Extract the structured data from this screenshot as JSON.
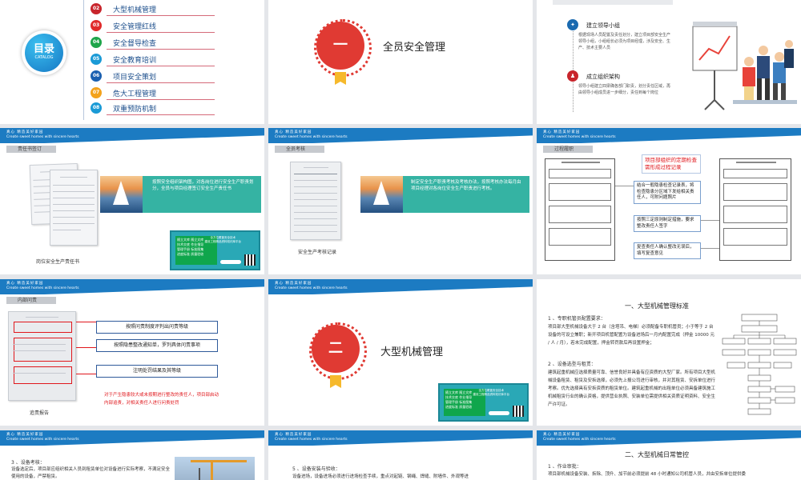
{
  "header": {
    "line1": "真心 精造美好家园",
    "line2": "Create sweet homes with sincere hearts"
  },
  "catalog": {
    "title": "目录",
    "subtitle": "CATALOG",
    "items": [
      {
        "num": "02",
        "label": "大型机械管理",
        "color": "#c8252c"
      },
      {
        "num": "03",
        "label": "安全管理红线",
        "color": "#e02b2b"
      },
      {
        "num": "04",
        "label": "安全督导检查",
        "color": "#1ea54a"
      },
      {
        "num": "05",
        "label": "安全教育培训",
        "color": "#1a9ad6"
      },
      {
        "num": "06",
        "label": "项目安全策划",
        "color": "#1b60b0"
      },
      {
        "num": "07",
        "label": "危大工程管理",
        "color": "#f3a21b"
      },
      {
        "num": "08",
        "label": "双重预防机制",
        "color": "#1a9ad6"
      }
    ]
  },
  "section1": {
    "numeral": "一",
    "title": "全员安全管理"
  },
  "section2": {
    "numeral": "二",
    "title": "大型机械管理"
  },
  "org": {
    "step1_title": "建立领导小组",
    "step1_text": "根据现场人员配置及责任划分，建立项目部安全生产领导小组，小组组长必须为项目经理，涉及安全、生产、技术主要人员",
    "step2_title": "成立组织架构",
    "step2_text": "领导小组建立四梁确各部门职责，划分责任区域，再由领导小组成员进一步细分，责任到每个岗位"
  },
  "resp": {
    "tab": "责任书签订",
    "banner": "按照安全组织架构图，对各岗位进行安全生产职责划分，全员与项目经理签订安全生产责任书",
    "caption": "岗位安全生产责任书"
  },
  "assess": {
    "tab": "全员考核",
    "banner": "制定安全生产职责考核及考核办法，按照考核办法每月由项目经理对各岗位安全生产职责进行考核。",
    "caption": "安全生产考核记录"
  },
  "process": {
    "tab": "过程履职",
    "title_red": "项目部组织的定期检查需形成过程记录",
    "box1": "结合一般隐患检查记录表，将检查隐患分区域下发给相关责任人，可附问题照片",
    "box2": "按照三定原则制定措施，要求整改责任人签字",
    "box3": "复查责任人确认整改无误后，填写复查意见"
  },
  "accountability": {
    "tab": "内部问责",
    "box1": "按照问责制度评判出问责等级",
    "box2": "按照隐患整改通知单，罗列具体问责事项",
    "box3": "注明处罚结果及其等级",
    "note": "对于产生隐患较大或未按期进行整改的责任人，项目部启动内部追责，对相关责任人进行问责处罚",
    "caption": "追责报告"
  },
  "ad": {
    "green_text": "随立文库 随立文库\n技术交底 作业指导\n管理手册 标准图集\n进度标准 质量验收",
    "side_text": "全方位覆盖安全技术\n建设工程精品资料知识库平台",
    "pill": "ZHUJIWANG.COM"
  },
  "standards": {
    "title": "一、大型机械管理标准",
    "p1_head": "1 、专职机管员配置要求：",
    "p1_body": "项目部大型机械设备大于 2 台（含塔吊、电梯）必须配备专职机管员；小于等于 2 台设备的可设立兼职；新开项目机管配置为设备进场后一月内配置完成（押金 10000 元 / 人 / 月），若未完成配置，押金转罚款后再设置押金；",
    "p2_head": "2 、设备选型与租赁：",
    "p2_body": "建筑起重机械应选择质量可靠、信誉良好并具备有应资质的大型厂家。所有项目大型机械设备租赁、租赁及安拆选择，必须先上报公司进行审核，并对其租赁、安拆单位进行考察。优先选择具有安拆资质的租赁单位。建筑起重机械的出租单位必须具备建筑施工机械租赁行业的确认资格，提供营业执照、安装单位需提供相关资质证明资料、安全生产许可证。"
  },
  "bottom": {
    "left_head": "3 、设备考核：",
    "left_body": "设备选定后，项目部应组织相关人员到租赁单位对设备进行实际考察，不满足安全使用的设备，严禁租赁。",
    "mid_head": "5 、设备安装与验收：",
    "mid_body": "设备进场，设备进场必须进行进场检查手续，重点对起链、钢绳、焊缝、附墙件、外观等进",
    "right_title": "二、大型机械日常管控",
    "right_head": "1 、作业审批：",
    "right_body": "项目部机械设备安装、拆除、顶升、加节前必须提前 48 小时通知公司机管人员，并由安拆单位提供委"
  }
}
